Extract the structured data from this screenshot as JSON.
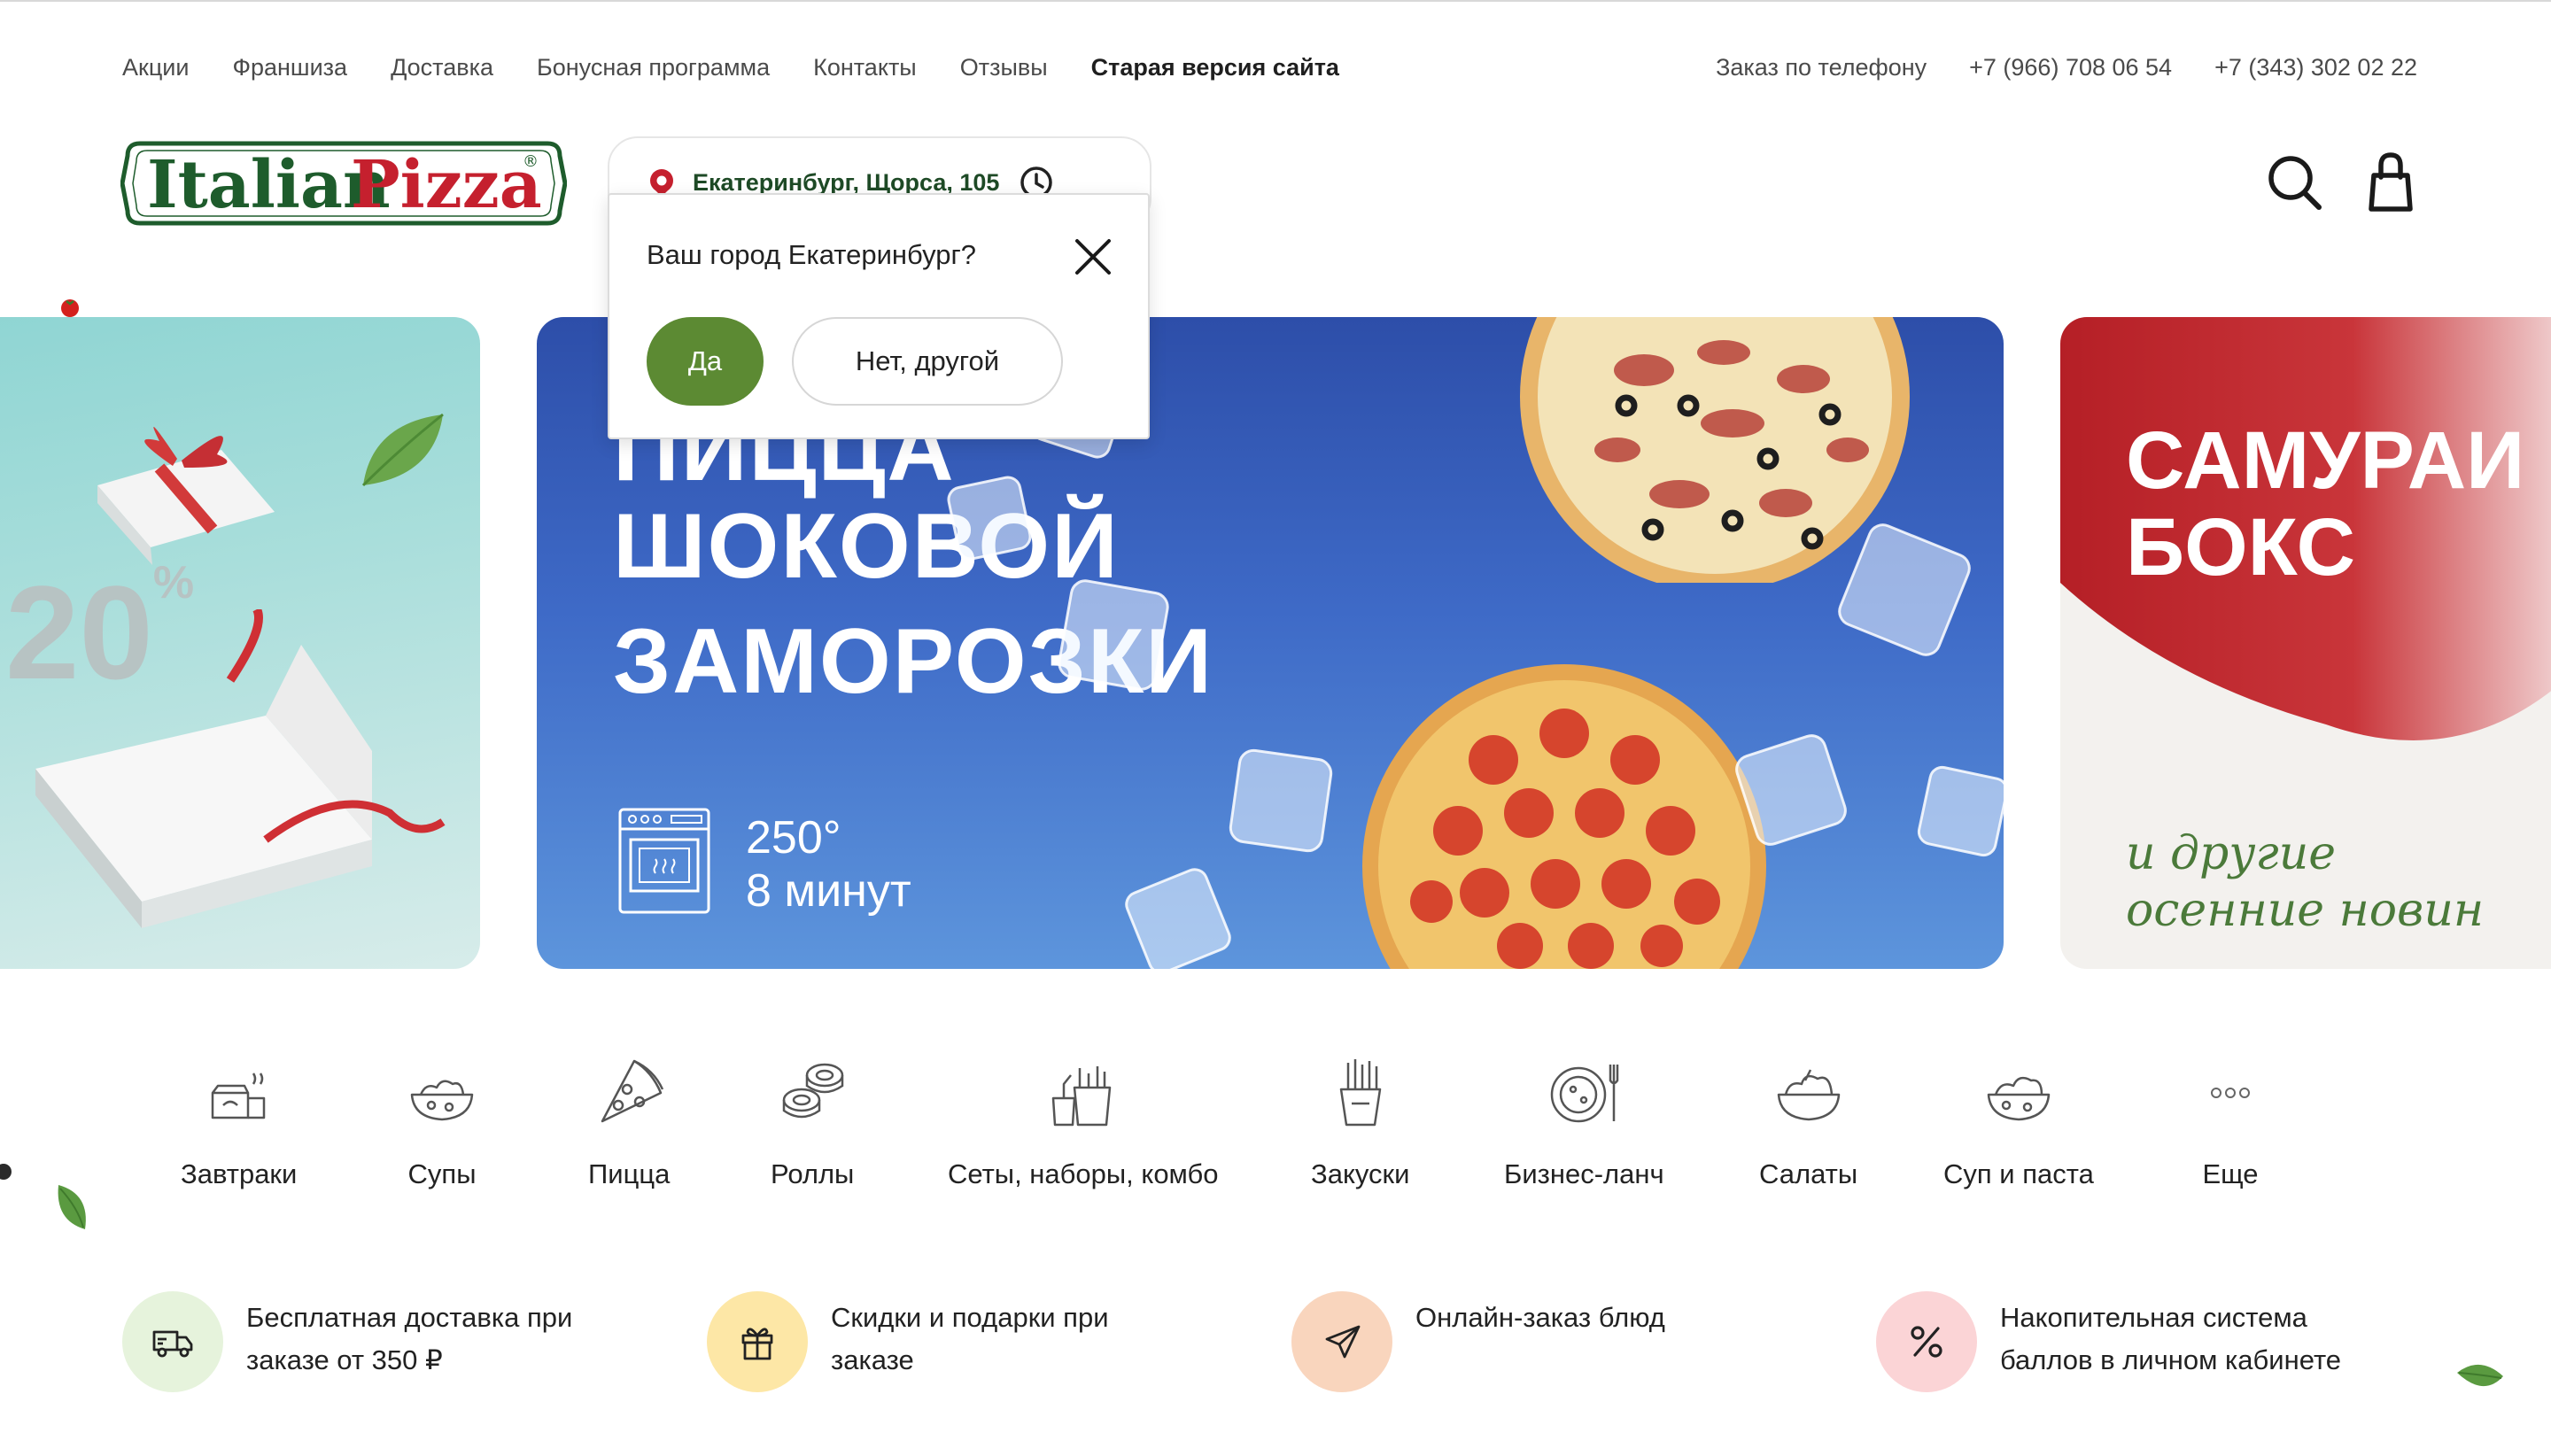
{
  "top_nav": {
    "links": [
      "Акции",
      "Франшиза",
      "Доставка",
      "Бонусная программа",
      "Контакты",
      "Отзывы"
    ],
    "old_site": "Старая версия сайта"
  },
  "phones": {
    "label": "Заказ по телефону",
    "phone1": "+7 (966) 708 06 54",
    "phone2": "+7 (343) 302 02 22"
  },
  "logo": {
    "brand_part1": "Italian",
    "brand_part2": "Pizza",
    "mark": "®"
  },
  "address": {
    "text": "Екатеринбург, Щорса, 105"
  },
  "city_popup": {
    "question": "Ваш город Екатеринбург?",
    "yes": "Да",
    "no": "Нет, другой"
  },
  "banners": {
    "left": {
      "percent": "20",
      "percent_sign": "%"
    },
    "main": {
      "line1": "ПИЦЦА",
      "line2": "ШОКОВОЙ",
      "line3": "ЗАМОРОЗКИ",
      "temp": "250°",
      "time": "8 минут"
    },
    "right": {
      "line1": "САМУРАИ",
      "line2": "БОКС",
      "sub1": "и другие",
      "sub2": "осенние новин"
    }
  },
  "categories": [
    {
      "label": "Завтраки",
      "icon": "breakfast-icon"
    },
    {
      "label": "Супы",
      "icon": "soup-icon"
    },
    {
      "label": "Пицца",
      "icon": "pizza-icon"
    },
    {
      "label": "Роллы",
      "icon": "rolls-icon"
    },
    {
      "label": "Сеты, наборы, комбо",
      "icon": "combo-icon"
    },
    {
      "label": "Закуски",
      "icon": "snacks-icon"
    },
    {
      "label": "Бизнес-ланч",
      "icon": "business-lunch-icon"
    },
    {
      "label": "Салаты",
      "icon": "salad-icon"
    },
    {
      "label": "Суп и паста",
      "icon": "soup-pasta-icon"
    },
    {
      "label": "Еще",
      "icon": "more-icon"
    }
  ],
  "features": [
    {
      "line1": "Бесплатная доставка при",
      "line2": "заказе от 350 ₽",
      "icon": "delivery-truck-icon",
      "color": "#e6f3dc"
    },
    {
      "line1": "Скидки и подарки при",
      "line2": "заказе",
      "icon": "gift-icon",
      "color": "#fde7a6"
    },
    {
      "line1": "Онлайн-заказ блюд",
      "line2": "",
      "icon": "send-icon",
      "color": "#f9d5bd"
    },
    {
      "line1": "Накопительная система",
      "line2": "баллов в личном кабинете",
      "icon": "percent-icon",
      "color": "#fbd4d6"
    }
  ],
  "colors": {
    "brand_green": "#1e5c2c",
    "brand_red": "#c5202e",
    "accent_green": "#5c8a33",
    "banner_blue": "#3e6ac7"
  }
}
